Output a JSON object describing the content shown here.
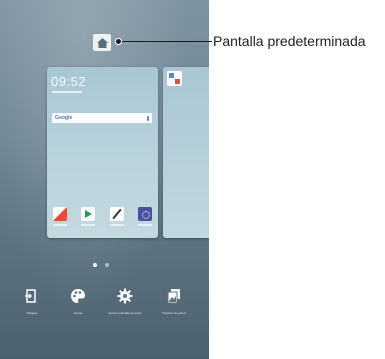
{
  "callout": {
    "label": "Pantalla predeterminada"
  },
  "preview": {
    "clock": "09:52",
    "search_brand": "Google",
    "app_icons": [
      "contacts-icon",
      "play-store-icon",
      "pen-icon",
      "settings-icon"
    ]
  },
  "pager": {
    "pages": 2,
    "active_index": 0
  },
  "menu": {
    "items": [
      {
        "icon": "widgets-icon",
        "label": "Widgets"
      },
      {
        "icon": "theme-palette-icon",
        "label": "Temas"
      },
      {
        "icon": "settings-gear-icon",
        "label": "Ajustes pantalla de inicio"
      },
      {
        "icon": "wallpaper-icon",
        "label": "Papeles de pared"
      }
    ]
  },
  "colors": {
    "wallpaper_top": "#7e93a1",
    "wallpaper_bottom": "#4c6170",
    "callout_text": "#222222"
  }
}
